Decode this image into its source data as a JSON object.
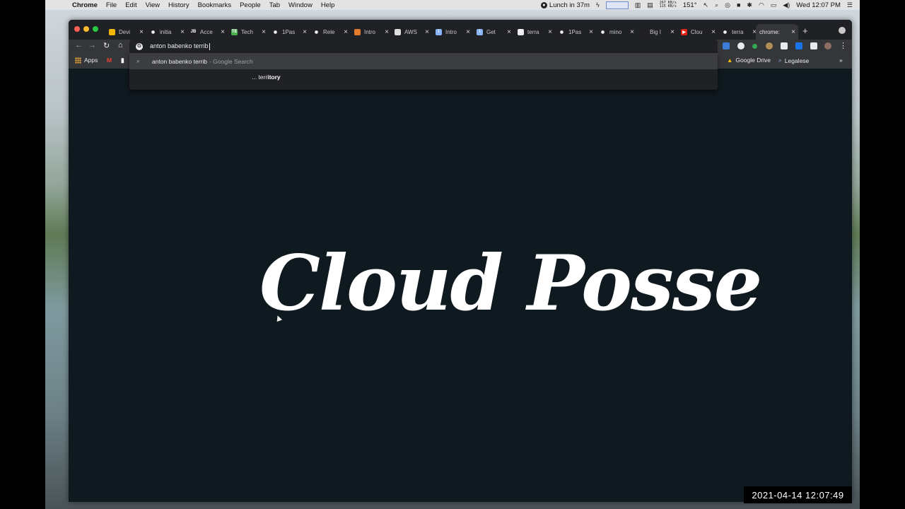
{
  "menubar": {
    "app_name": "Chrome",
    "menus": [
      "File",
      "Edit",
      "View",
      "History",
      "Bookmarks",
      "People",
      "Tab",
      "Window",
      "Help"
    ],
    "lunch_text": "Lunch in 37m",
    "net_up": "267 KB/s",
    "net_down": "115 KB/s",
    "temperature": "151°",
    "clock": "Wed 12:07 PM"
  },
  "tabs": [
    {
      "label": "Devi",
      "fav_color": "#f2b600",
      "glyph": ""
    },
    {
      "label": "initia",
      "fav_color": "#202124",
      "glyph": "◉"
    },
    {
      "label": "Acce",
      "fav_color": "#202124",
      "glyph": "JB"
    },
    {
      "label": "Tech",
      "fav_color": "#4caf50",
      "glyph": "TE"
    },
    {
      "label": "1Pas",
      "fav_color": "#202124",
      "glyph": "◉"
    },
    {
      "label": "Rele",
      "fav_color": "#202124",
      "glyph": "◉"
    },
    {
      "label": "Intro",
      "fav_color": "#e37b2b",
      "glyph": ""
    },
    {
      "label": "AWS",
      "fav_color": "#ddd",
      "glyph": ""
    },
    {
      "label": "Intro",
      "fav_color": "#8ab4f8",
      "glyph": "i"
    },
    {
      "label": "Get",
      "fav_color": "#8ab4f8",
      "glyph": "i"
    },
    {
      "label": "terra",
      "fav_color": "#e8eaed",
      "glyph": "G"
    },
    {
      "label": "1Pas",
      "fav_color": "#202124",
      "glyph": "◉"
    },
    {
      "label": "mino",
      "fav_color": "#202124",
      "glyph": "◉"
    },
    {
      "label": "Big I",
      "fav_color": "#202124",
      "glyph": ""
    },
    {
      "label": "Clou",
      "fav_color": "#e62117",
      "glyph": "▶"
    },
    {
      "label": "terra",
      "fav_color": "#202124",
      "glyph": "◉"
    },
    {
      "label": "chrome:",
      "fav_color": "",
      "glyph": "",
      "active": true
    }
  ],
  "omnibox": {
    "query": "anton babenko terrib"
  },
  "suggestions": {
    "first": {
      "text": "anton babenko terrib",
      "source": "- Google Search"
    },
    "second": {
      "prefix": "... terr",
      "bold": "itory"
    }
  },
  "bookmarks": {
    "apps": "Apps",
    "google_drive": "Google Drive",
    "legalese": "Legalese",
    "more": "»"
  },
  "page": {
    "logo_text": "Cloud Posse"
  },
  "overlay": {
    "timestamp": "2021-04-14  12:07:49"
  }
}
